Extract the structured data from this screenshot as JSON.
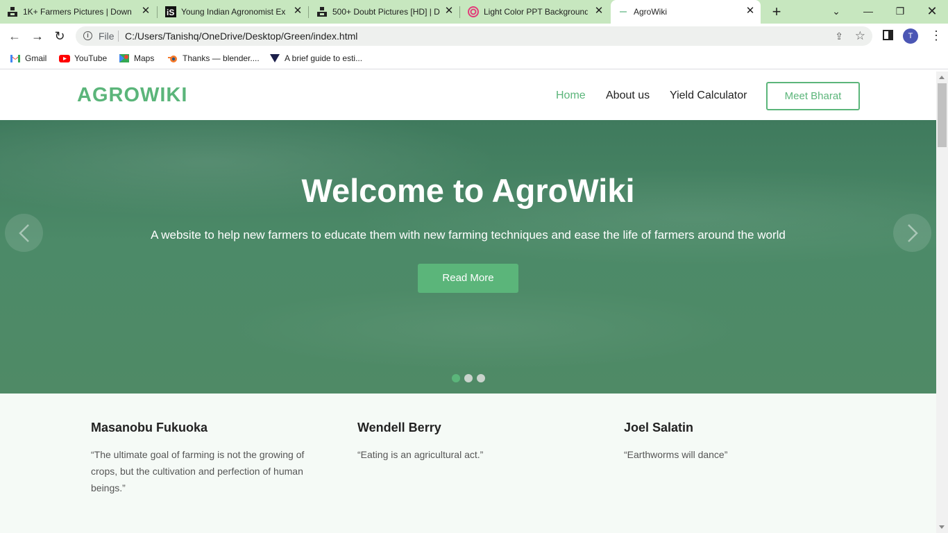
{
  "browser": {
    "tabs": [
      {
        "title": "1K+ Farmers Pictures | Down",
        "favicon": "unsplash-icon"
      },
      {
        "title": "Young Indian Agronomist Ex",
        "favicon": "istock-icon"
      },
      {
        "title": "500+ Doubt Pictures [HD] | D",
        "favicon": "unsplash-icon"
      },
      {
        "title": "Light Color PPT Background",
        "favicon": "slidesgo-icon"
      },
      {
        "title": "AgroWiki",
        "favicon": "page-icon",
        "active": true
      }
    ],
    "address": {
      "scheme": "File",
      "url": "C:/Users/Tanishq/OneDrive/Desktop/Green/index.html"
    },
    "avatar_initial": "T",
    "bookmarks": [
      {
        "label": "Gmail",
        "icon": "gmail-icon"
      },
      {
        "label": "YouTube",
        "icon": "youtube-icon"
      },
      {
        "label": "Maps",
        "icon": "maps-icon"
      },
      {
        "label": "Thanks — blender....",
        "icon": "blender-icon"
      },
      {
        "label": "A brief guide to esti...",
        "icon": "bookmark-icon"
      }
    ]
  },
  "site": {
    "logo": "AGROWIKI",
    "nav": [
      {
        "label": "Home",
        "current": true
      },
      {
        "label": "About us"
      },
      {
        "label": "Yield Calculator"
      }
    ],
    "cta": "Meet Bharat",
    "hero": {
      "title": "Welcome to AgroWiki",
      "subtitle": "A website to help new farmers to educate them with new farming techniques and ease the life of farmers around the world",
      "button": "Read More",
      "slides": 3,
      "active_slide": 1
    },
    "quotes": [
      {
        "author": "Masanobu Fukuoka",
        "text": "“The ultimate goal of farming is not the growing of crops, but the cultivation and perfection of human beings.”"
      },
      {
        "author": "Wendell Berry",
        "text": "“Eating is an agricultural act.”"
      },
      {
        "author": "Joel Salatin",
        "text": "“Earthworms will dance”"
      }
    ],
    "colors": {
      "accent": "#5bb57a",
      "hero": "#4c8a68",
      "tabstrip": "#c7e7bf"
    }
  }
}
